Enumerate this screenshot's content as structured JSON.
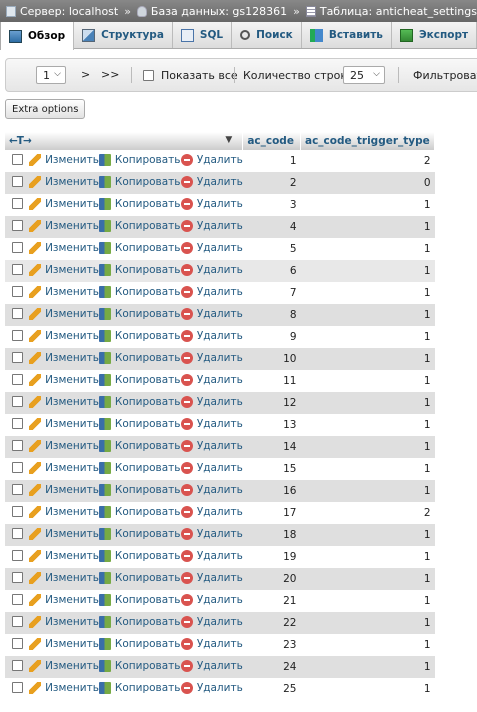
{
  "breadcrumb": {
    "server": "Сервер: localhost",
    "database": "База данных: gs128361",
    "table": "Таблица: anticheat_settings",
    "separator": "»"
  },
  "tabs": [
    {
      "label": "Обзор",
      "icon": "browse-icon",
      "active": true
    },
    {
      "label": "Структура",
      "icon": "structure-icon"
    },
    {
      "label": "SQL",
      "icon": "sql-icon"
    },
    {
      "label": "Поиск",
      "icon": "search-icon"
    },
    {
      "label": "Вставить",
      "icon": "insert-icon"
    },
    {
      "label": "Экспорт",
      "icon": "export-icon"
    }
  ],
  "navigation": {
    "page": "1",
    "next": ">",
    "last": ">>",
    "show_all": "Показать все",
    "row_count_label": "Количество строк:",
    "row_count": "25",
    "filter_label": "Фильтровать"
  },
  "extra_options": "Extra options",
  "table": {
    "arrows": "←T→",
    "columns": [
      "ac_code",
      "ac_code_trigger_type"
    ],
    "actions": {
      "edit": "Изменить",
      "copy": "Копировать",
      "delete": "Удалить"
    },
    "rows": [
      [
        "1",
        "2"
      ],
      [
        "2",
        "0"
      ],
      [
        "3",
        "1"
      ],
      [
        "4",
        "1"
      ],
      [
        "5",
        "1"
      ],
      [
        "6",
        "1"
      ],
      [
        "7",
        "1"
      ],
      [
        "8",
        "1"
      ],
      [
        "9",
        "1"
      ],
      [
        "10",
        "1"
      ],
      [
        "11",
        "1"
      ],
      [
        "12",
        "1"
      ],
      [
        "13",
        "1"
      ],
      [
        "14",
        "1"
      ],
      [
        "15",
        "1"
      ],
      [
        "16",
        "1"
      ],
      [
        "17",
        "2"
      ],
      [
        "18",
        "1"
      ],
      [
        "19",
        "1"
      ],
      [
        "20",
        "1"
      ],
      [
        "21",
        "1"
      ],
      [
        "22",
        "1"
      ],
      [
        "23",
        "1"
      ],
      [
        "24",
        "1"
      ],
      [
        "25",
        "1"
      ]
    ]
  }
}
